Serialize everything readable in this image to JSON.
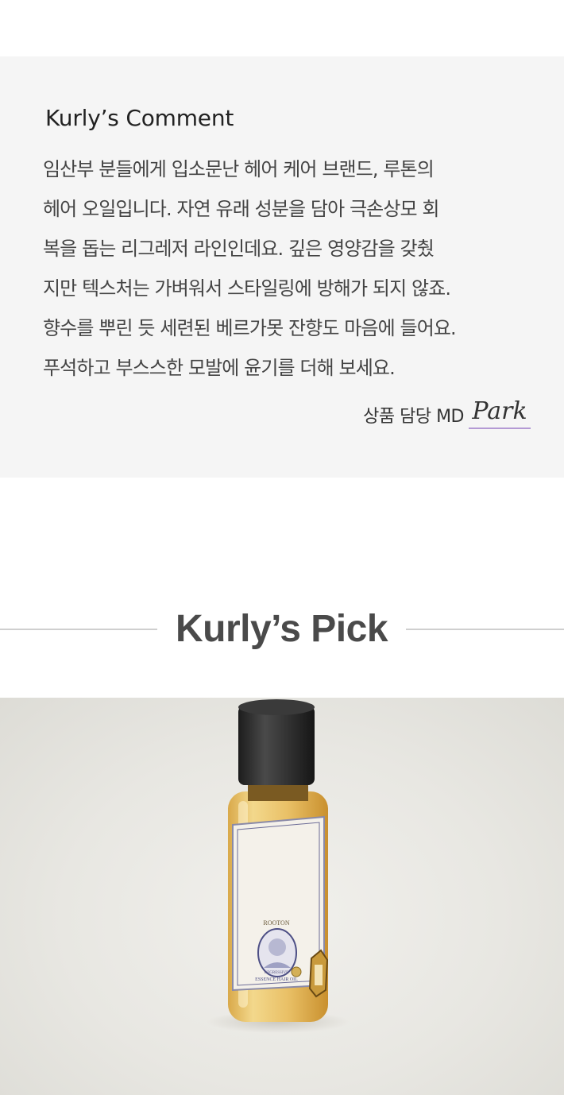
{
  "comment": {
    "title": "Kurly’s Comment",
    "lines": [
      "임산부 분들에게 입소문난 헤어 케어 브랜드, 루톤의",
      "헤어 오일입니다. 자연 유래 성분을 담아 극손상모 회",
      "복을 돕는 리그레저 라인인데요. 깊은 영양감을 갖췄",
      "지만 텍스처는 가벼워서 스타일링에 방해가 되지 않죠.",
      "향수를 뿌린 듯 세련된 베르가못 잔향도 마음에 들어요.",
      "푸석하고 부스스한 모발에 윤기를 더해 보세요."
    ],
    "signature_label": "상품 담당 MD",
    "signature_name": "Park"
  },
  "pick": {
    "title": "Kurly’s Pick"
  },
  "product": {
    "brand": "ROOTON",
    "label_line_1": "REGRESSIVE",
    "label_line_2": "ESSENCE HAIR OIL"
  },
  "colors": {
    "panel_background": "#f5f5f5",
    "signature_underline": "#b49ad4",
    "divider": "#cfcfcf"
  }
}
